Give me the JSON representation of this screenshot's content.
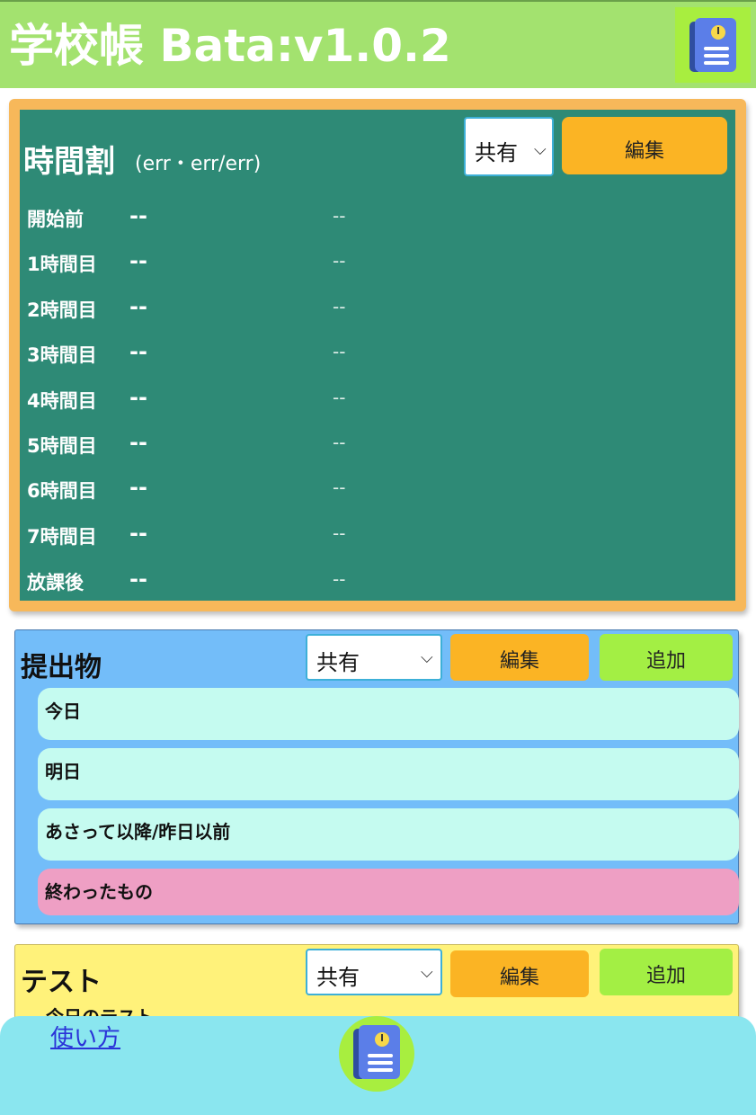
{
  "header": {
    "title": "学校帳 Bata:v1.0.2",
    "icon": "notebook-clock-icon"
  },
  "timetable": {
    "title": "時間割",
    "subtitle": "(err・err/err)",
    "share_select": "共有",
    "edit_label": "編集",
    "periods": [
      {
        "name": "開始前",
        "subject": "--",
        "room": "--"
      },
      {
        "name": "1時間目",
        "subject": "--",
        "room": "--"
      },
      {
        "name": "2時間目",
        "subject": "--",
        "room": "--"
      },
      {
        "name": "3時間目",
        "subject": "--",
        "room": "--"
      },
      {
        "name": "4時間目",
        "subject": "--",
        "room": "--"
      },
      {
        "name": "5時間目",
        "subject": "--",
        "room": "--"
      },
      {
        "name": "6時間目",
        "subject": "--",
        "room": "--"
      },
      {
        "name": "7時間目",
        "subject": "--",
        "room": "--"
      },
      {
        "name": "放課後",
        "subject": "--",
        "room": "--"
      }
    ]
  },
  "submissions": {
    "title": "提出物",
    "share_select": "共有",
    "edit_label": "編集",
    "add_label": "追加",
    "groups": [
      "今日",
      "明日",
      "あさって以降/昨日以前",
      "終わったもの"
    ]
  },
  "tests": {
    "title": "テスト",
    "share_select": "共有",
    "edit_label": "編集",
    "add_label": "追加",
    "first_group": "今日のテスト"
  },
  "footer": {
    "help_link": "使い方",
    "home_icon": "notebook-clock-icon"
  },
  "colors": {
    "header": "#a3e26f",
    "timetable_board": "#2e8a76",
    "timetable_frame": "#f7b85a",
    "submissions_bg": "#73bdf9",
    "tests_bg": "#fff27a",
    "edit_button": "#fbb424",
    "add_button": "#a3ef44",
    "card_blue": "#c5fbf0",
    "card_pink": "#ee9fc4",
    "footer": "#8ae6ef"
  }
}
